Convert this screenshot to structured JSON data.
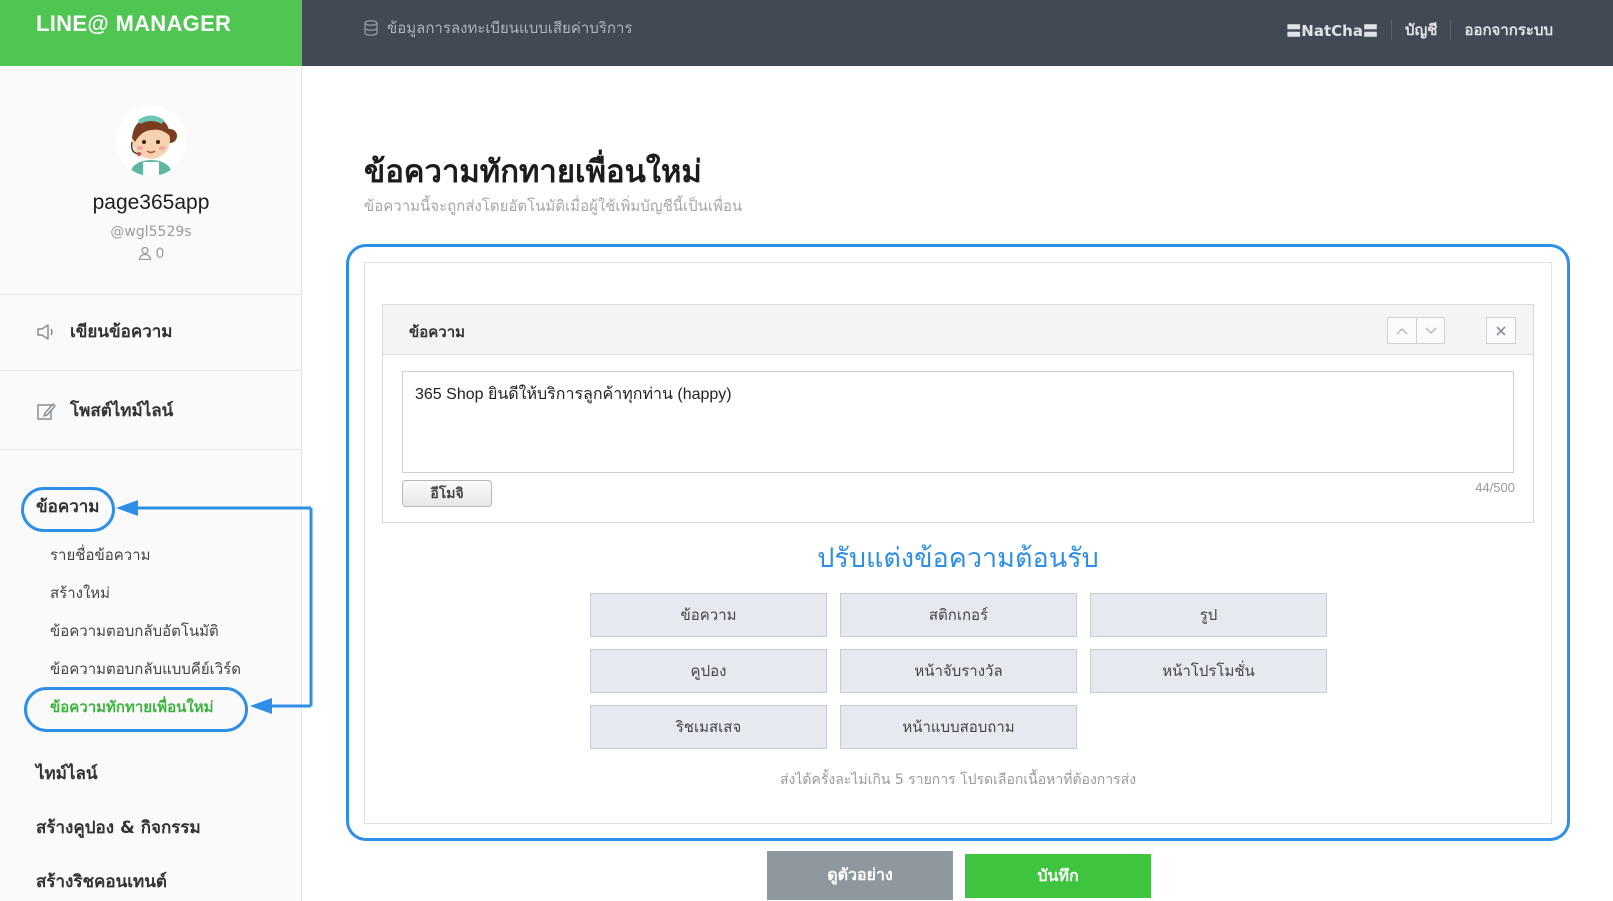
{
  "header": {
    "brand": "LINE@ MANAGER",
    "billing_link": "ข้อมูลการลงทะเบียนแบบเสียค่าบริการ",
    "user": "〓NatCha〓",
    "account_link": "บัญชี",
    "logout_link": "ออกจากระบบ"
  },
  "account": {
    "name": "page365app",
    "id": "@wgl5529s",
    "friends": "0"
  },
  "sidebar": {
    "broadcast": "เขียนข้อความ",
    "timeline_post": "โพสต์ไทม์ไลน์",
    "messages_section": "ข้อความ",
    "sub_items": [
      {
        "label": "รายชื่อข้อความ"
      },
      {
        "label": "สร้างใหม่"
      },
      {
        "label": "ข้อความตอบกลับอัตโนมัติ"
      },
      {
        "label": "ข้อความตอบกลับแบบคีย์เวิร์ด"
      },
      {
        "label": "ข้อความทักทายเพื่อนใหม่"
      }
    ],
    "timeline_section": "ไทม์ไลน์",
    "coupon_section": "สร้างคูปอง & กิจกรรม",
    "rich_section": "สร้างริชคอนเทนต์"
  },
  "main": {
    "title": "ข้อความทักทายเพื่อนใหม่",
    "subtitle": "ข้อความนี้จะถูกส่งโดยอัตโนมัติเมื่อผู้ใช้เพิ่มบัญชีนี้เป็นเพื่อน",
    "message_label": "ข้อความ",
    "message_text": "365 Shop ยินดีให้บริการลูกค้าทุกท่าน (happy)",
    "emoji_button": "อีโมจิ",
    "char_count": "44/500",
    "customize_title": "ปรับแต่งข้อความต้อนรับ",
    "options": [
      "ข้อความ",
      "สติกเกอร์",
      "รูป",
      "คูปอง",
      "หน้าจับรางวัล",
      "หน้าโปรโมชั่น",
      "ริชเมสเสจ",
      "หน้าแบบสอบถาม"
    ],
    "limit_note": "ส่งได้ครั้งละไม่เกิน 5 รายการ โปรดเลือกเนื้อหาที่ต้องการส่ง",
    "preview_button": "ดูตัวอย่าง",
    "save_button": "บันทึก"
  },
  "colors": {
    "brand_green": "#4fc552",
    "header_dark": "#414a54",
    "highlight_blue": "#2e8fe8",
    "active_green": "#3cb53f"
  }
}
